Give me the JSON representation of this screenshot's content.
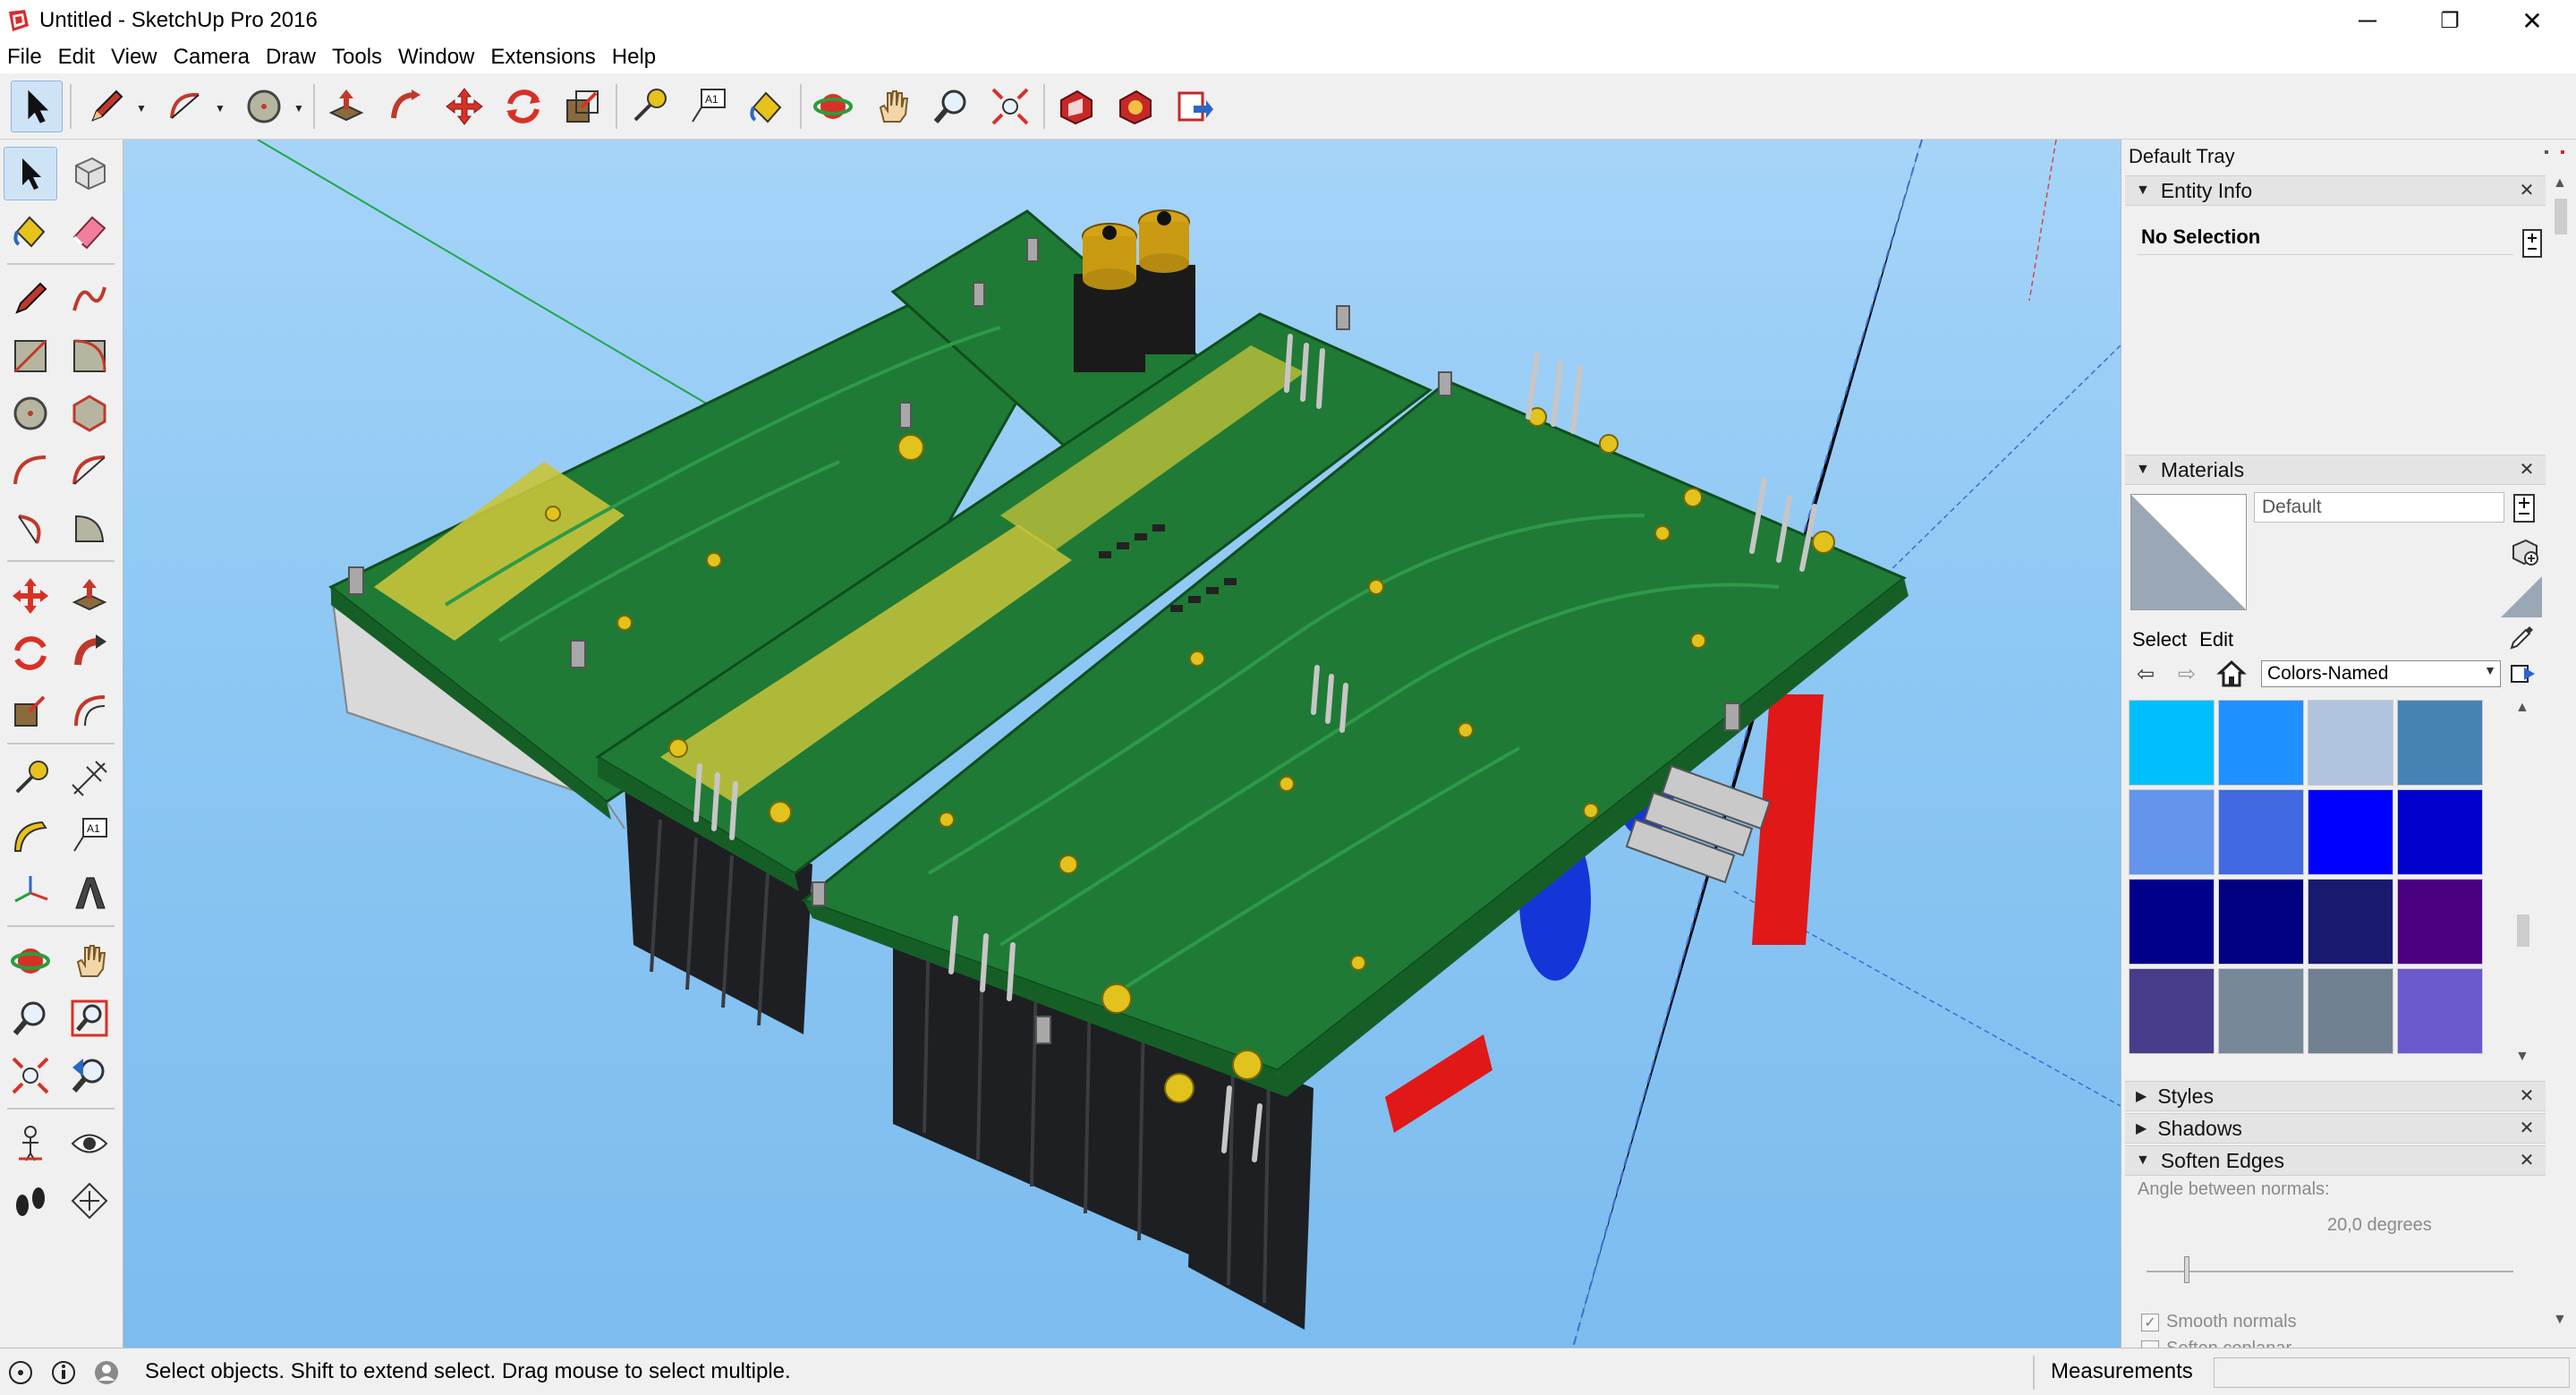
{
  "window": {
    "title": "Untitled - SketchUp Pro 2016",
    "minimize": "─",
    "restore": "❐",
    "close": "✕"
  },
  "menu": [
    "File",
    "Edit",
    "View",
    "Camera",
    "Draw",
    "Tools",
    "Window",
    "Extensions",
    "Help"
  ],
  "top_toolbar_icons": [
    "select-icon",
    "pencil-icon",
    "arc-icon",
    "circle-icon",
    "push-pull-icon",
    "follow-me-icon",
    "move-icon",
    "rotate-icon",
    "scale-icon",
    "tape-measure-icon",
    "text-icon",
    "paint-bucket-icon",
    "orbit-icon",
    "pan-icon",
    "zoom-icon",
    "zoom-extents-icon",
    "warehouse-icon",
    "extension-warehouse-icon",
    "send-to-layout-icon"
  ],
  "left_toolbar_icons": [
    "select-icon",
    "make-component-icon",
    "paint-bucket-icon",
    "eraser-icon",
    "pencil-icon",
    "freehand-icon",
    "rectangle-icon",
    "rotated-rectangle-icon",
    "circle-icon",
    "polygon-icon",
    "arc-icon",
    "two-point-arc-icon",
    "three-point-arc-icon",
    "pie-icon",
    "move-icon",
    "push-pull-icon",
    "rotate-icon",
    "follow-me-icon",
    "scale-icon",
    "offset-icon",
    "tape-measure-icon",
    "dimension-icon",
    "protractor-icon",
    "text-icon",
    "axes-icon",
    "3d-text-icon",
    "orbit-icon",
    "pan-icon",
    "zoom-icon",
    "zoom-window-icon",
    "zoom-extents-icon",
    "previous-view-icon",
    "position-camera-icon",
    "look-around-icon",
    "walk-icon",
    "section-plane-icon"
  ],
  "tray": {
    "title": "Default Tray",
    "entity_info": {
      "title": "Entity Info",
      "selection": "No Selection"
    },
    "materials": {
      "title": "Materials",
      "name": "Default",
      "tab_select": "Select",
      "tab_edit": "Edit",
      "collection": "Colors-Named",
      "swatches": [
        "#00bfff",
        "#1e90ff",
        "#b0c4de",
        "#4682b4",
        "#6495ed",
        "#4169e1",
        "#0000ff",
        "#0000cd",
        "#00008b",
        "#000080",
        "#191970",
        "#4b0082",
        "#483d8b",
        "#778899",
        "#708090",
        "#6a5acd"
      ]
    },
    "styles": {
      "title": "Styles"
    },
    "shadows": {
      "title": "Shadows"
    },
    "soften_edges": {
      "title": "Soften Edges",
      "angle_label": "Angle between normals:",
      "angle_value": "20,0  degrees",
      "angle_fraction": 0.11,
      "smooth_normals": "Smooth normals",
      "smooth_normals_checked": true,
      "soften_coplanar": "Soften coplanar",
      "soften_coplanar_checked": false
    }
  },
  "status": {
    "message": "Select objects. Shift to extend select. Drag mouse to select multiple.",
    "measurements_label": "Measurements",
    "measurements_value": ""
  },
  "colors": {
    "sky_top": "#a6d4f8",
    "sky_bottom": "#7cbcef",
    "pcb_green": "#1f7a35",
    "pcb_dark": "#155f27",
    "pad_gold": "#e2c21c",
    "copper_fill": "#c9c43a",
    "heatsink": "#202225",
    "capacitor_red": "#e01818",
    "capacitor_blue": "#1436d8"
  }
}
